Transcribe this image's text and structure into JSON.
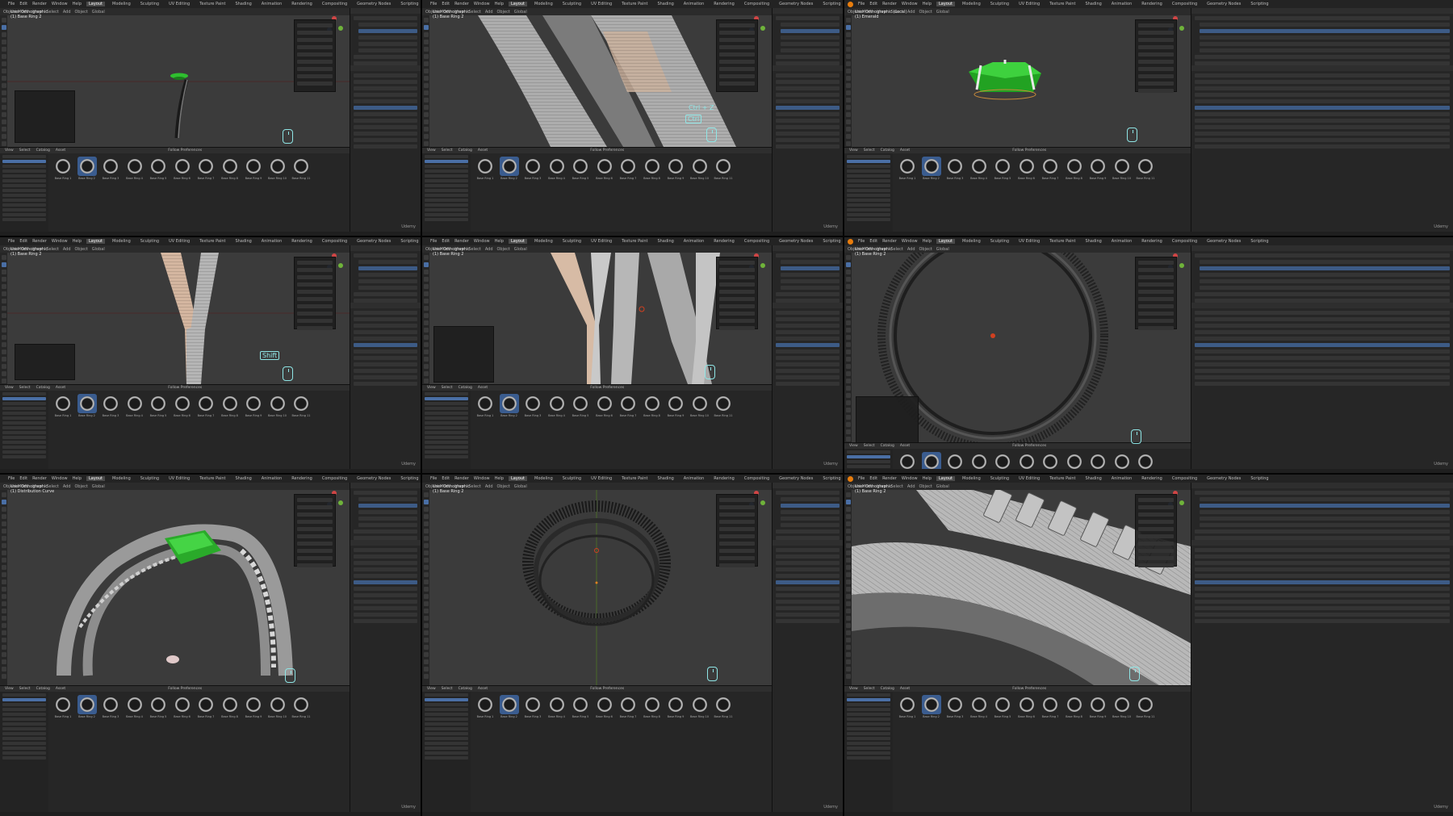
{
  "app": {
    "name": "Blender",
    "menus": [
      "File",
      "Edit",
      "Render",
      "Window",
      "Help"
    ],
    "workspace_tabs": [
      "Layout",
      "Modeling",
      "Sculpting",
      "UV Editing",
      "Texture Paint",
      "Shading",
      "Animation",
      "Rendering",
      "Compositing",
      "Geometry Nodes",
      "Scripting"
    ],
    "active_workspace": "Layout",
    "header_items": [
      "Object Mode",
      "View",
      "Select",
      "Add",
      "Object",
      "Global"
    ]
  },
  "asset_browser": {
    "menus": [
      "View",
      "Select",
      "Catalog",
      "Asset"
    ],
    "title": "Follow Preferences",
    "selected_index": 1,
    "assets": [
      "Base Ring 1",
      "Base Ring 2",
      "Base Ring 3",
      "Base Ring 4",
      "Base Ring 5",
      "Base Ring 6",
      "Base Ring 7",
      "Base Ring 8",
      "Base Ring 9",
      "Base Ring 10",
      "Base Ring 11"
    ]
  },
  "overlays": {
    "ctrl_z_caption": "Ctrl + Z",
    "ctrl_key": "Ctrl",
    "shift_key": "Shift"
  },
  "watermark": "Udemy",
  "panels": [
    {
      "id": "p1",
      "view": "User Orthographic",
      "object": "(1) Base Ring 2"
    },
    {
      "id": "p2",
      "view": "User Orthographic",
      "object": "(1) Base Ring 2"
    },
    {
      "id": "p3",
      "view": "User Orthographic (Local)",
      "object": "(1) Emerald"
    },
    {
      "id": "p4",
      "view": "User Orthographic",
      "object": "(1) Base Ring 2"
    },
    {
      "id": "p5",
      "view": "User Orthographic",
      "object": "(1) Base Ring 2"
    },
    {
      "id": "p6",
      "view": "User Orthographic",
      "object": "(1) Base Ring 2"
    },
    {
      "id": "p7",
      "view": "User Orthographic",
      "object": "(1) Distribution Curve"
    },
    {
      "id": "p8",
      "view": "User Orthographic",
      "object": "(1) Base Ring 2"
    },
    {
      "id": "p9",
      "view": "User Orthographic",
      "object": "(1) Base Ring 2"
    }
  ]
}
